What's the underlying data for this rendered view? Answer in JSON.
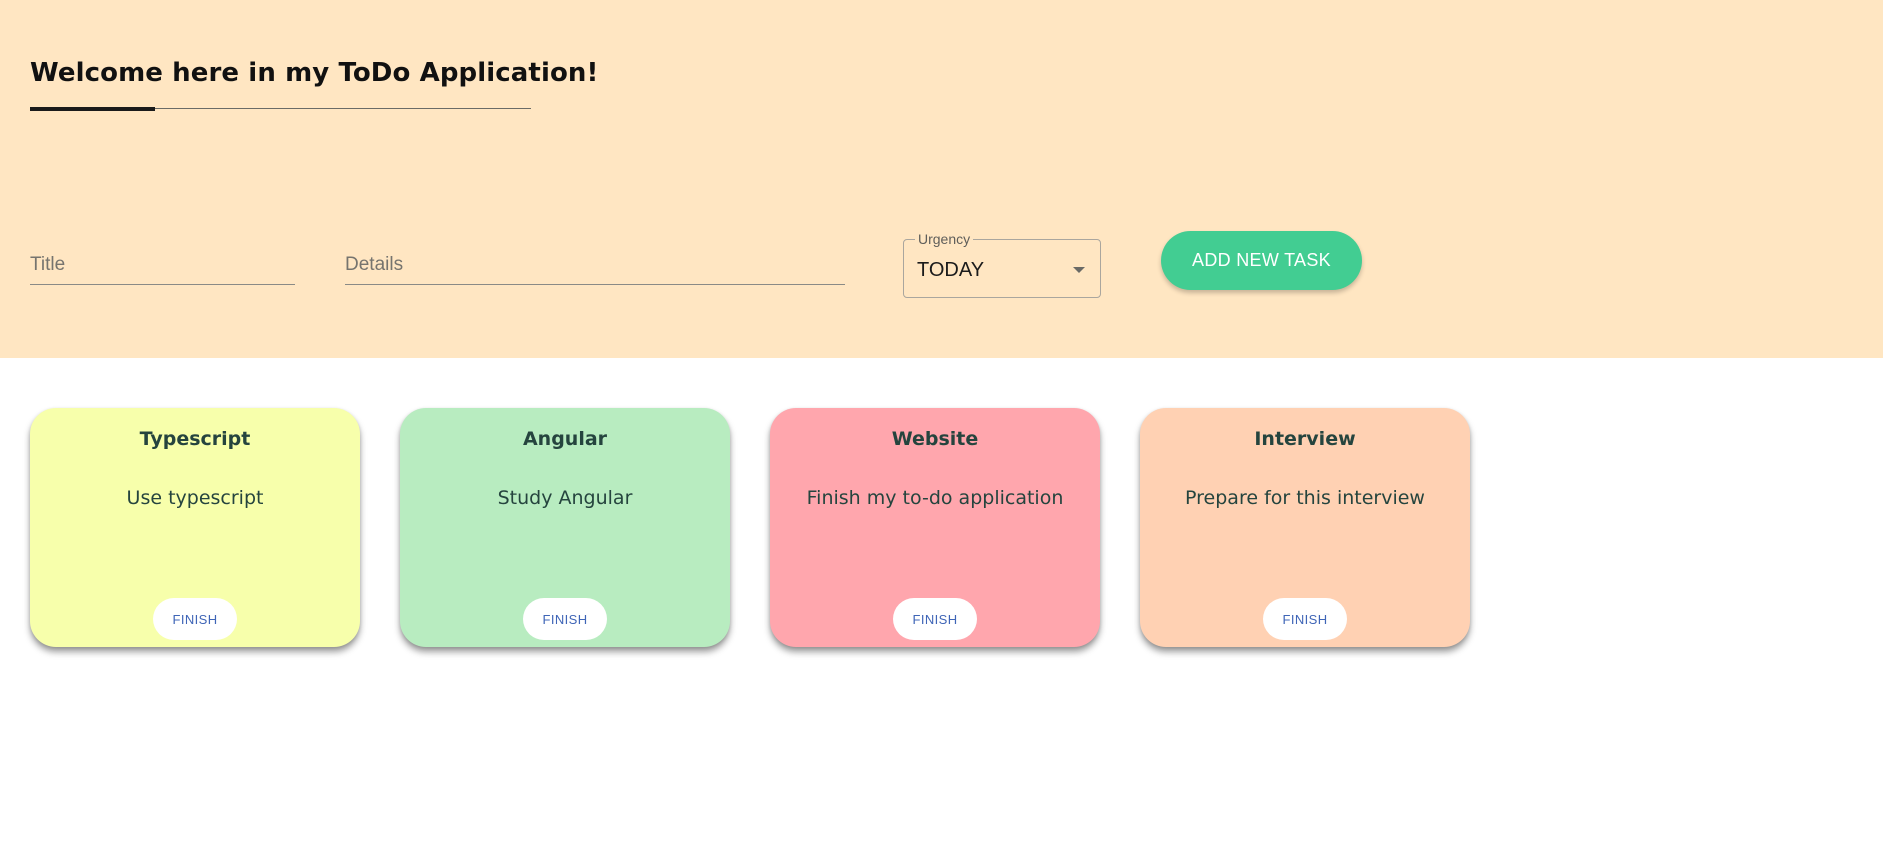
{
  "header": {
    "welcome_title": "Welcome here in my ToDo Application!"
  },
  "form": {
    "title_placeholder": "Title",
    "details_placeholder": "Details",
    "urgency_label": "Urgency",
    "urgency_value": "TODAY",
    "add_button_label": "ADD NEW TASK"
  },
  "tasks": [
    {
      "title": "Typescript",
      "details": "Use typescript",
      "finish_label": "FINISH",
      "color": "#f7ffab"
    },
    {
      "title": "Angular",
      "details": "Study Angular",
      "finish_label": "FINISH",
      "color": "#b8ecc0"
    },
    {
      "title": "Website",
      "details": "Finish my to-do application",
      "finish_label": "FINISH",
      "color": "#ffa6ad"
    },
    {
      "title": "Interview",
      "details": "Prepare for this interview",
      "finish_label": "FINISH",
      "color": "#ffd1b3"
    }
  ],
  "colors": {
    "header_background": "#ffe6c2",
    "accent_green": "#42cd92",
    "finish_text": "#3f65b7"
  }
}
